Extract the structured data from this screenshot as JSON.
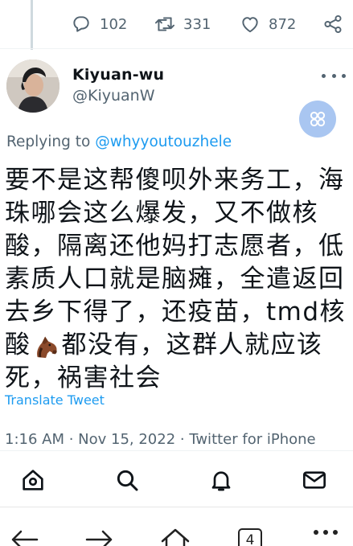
{
  "actions": {
    "reply_count": "102",
    "retweet_count": "331",
    "like_count": "872"
  },
  "author": {
    "display_name": "Kiyuan-wu",
    "handle": "@KiyuanW"
  },
  "replying": {
    "prefix": "Replying to ",
    "mention": "@whyyoutouzhele"
  },
  "tweet": {
    "lines": [
      "要不是这帮傻呗外来务工，海",
      "珠哪会这么爆发，又不做核",
      "酸，隔离还他妈打志愿者，低",
      "素质人口就是脑瘫，全遣返回",
      "去乡下得了，还疫苗，tmd核",
      "都没有，这群人就应该",
      "死，祸害社会"
    ],
    "line6_prefix": "酸",
    "emoji_name": "horse-face",
    "translate_label": "Translate Tweet",
    "timestamp": "1:16 AM · Nov 15, 2022 · Twitter for iPhone"
  },
  "browser": {
    "tab_count": "4"
  },
  "colors": {
    "accent": "#1d9bf0",
    "secondary_text": "#536471",
    "float_button": "#a9c6f1"
  },
  "icons": [
    "reply-icon",
    "retweet-icon",
    "like-icon",
    "share-icon",
    "more-icon",
    "home-icon",
    "search-icon",
    "notifications-icon",
    "messages-icon",
    "back-icon",
    "forward-icon",
    "browser-home-icon",
    "tabs-icon",
    "menu-icon"
  ]
}
